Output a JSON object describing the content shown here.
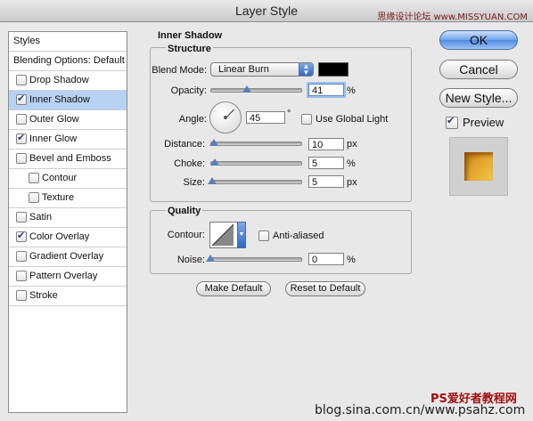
{
  "window": {
    "title": "Layer Style",
    "watermark_top": "思缘设计论坛 www.MISSYUAN.COM",
    "watermark_bottom_1": "PS爱好者教程网",
    "watermark_bottom_2": "blog.sina.com.cn/www.psahz.com"
  },
  "sidebar": {
    "items": [
      {
        "label": "Styles",
        "checkbox": false,
        "checked": false,
        "selected": false
      },
      {
        "label": "Blending Options: Default",
        "checkbox": false,
        "checked": false,
        "selected": false
      },
      {
        "label": "Drop Shadow",
        "checkbox": true,
        "checked": false,
        "selected": false
      },
      {
        "label": "Inner Shadow",
        "checkbox": true,
        "checked": true,
        "selected": true
      },
      {
        "label": "Outer Glow",
        "checkbox": true,
        "checked": false,
        "selected": false
      },
      {
        "label": "Inner Glow",
        "checkbox": true,
        "checked": true,
        "selected": false
      },
      {
        "label": "Bevel and Emboss",
        "checkbox": true,
        "checked": false,
        "selected": false
      },
      {
        "label": "Contour",
        "checkbox": true,
        "checked": false,
        "selected": false,
        "indent": true
      },
      {
        "label": "Texture",
        "checkbox": true,
        "checked": false,
        "selected": false,
        "indent": true
      },
      {
        "label": "Satin",
        "checkbox": true,
        "checked": false,
        "selected": false
      },
      {
        "label": "Color Overlay",
        "checkbox": true,
        "checked": true,
        "selected": false
      },
      {
        "label": "Gradient Overlay",
        "checkbox": true,
        "checked": false,
        "selected": false
      },
      {
        "label": "Pattern Overlay",
        "checkbox": true,
        "checked": false,
        "selected": false
      },
      {
        "label": "Stroke",
        "checkbox": true,
        "checked": false,
        "selected": false
      }
    ]
  },
  "inner_shadow": {
    "group_title": "Inner Shadow",
    "structure": {
      "title": "Structure",
      "blend_mode_label": "Blend Mode:",
      "blend_mode_value": "Linear Burn",
      "shadow_color": "#000000",
      "opacity_label": "Opacity:",
      "opacity_value": "41",
      "opacity_unit": "%",
      "opacity_level": 0.41,
      "angle_label": "Angle:",
      "angle_value": "45",
      "angle_unit": "°",
      "use_global_light_label": "Use Global Light",
      "use_global_light": false,
      "distance_label": "Distance:",
      "distance_value": "10",
      "distance_unit": "px",
      "distance_level": 0.04,
      "choke_label": "Choke:",
      "choke_value": "5",
      "choke_unit": "%",
      "choke_level": 0.05,
      "size_label": "Size:",
      "size_value": "5",
      "size_unit": "px",
      "size_level": 0.02
    },
    "quality": {
      "title": "Quality",
      "contour_label": "Contour:",
      "anti_aliased_label": "Anti-aliased",
      "anti_aliased": false,
      "noise_label": "Noise:",
      "noise_value": "0",
      "noise_unit": "%",
      "noise_level": 0.0
    },
    "make_default_label": "Make Default",
    "reset_default_label": "Reset to Default"
  },
  "actions": {
    "ok_label": "OK",
    "cancel_label": "Cancel",
    "new_style_label": "New Style...",
    "preview_label": "Preview",
    "preview_checked": true,
    "preview_color": "#e0a22c"
  }
}
